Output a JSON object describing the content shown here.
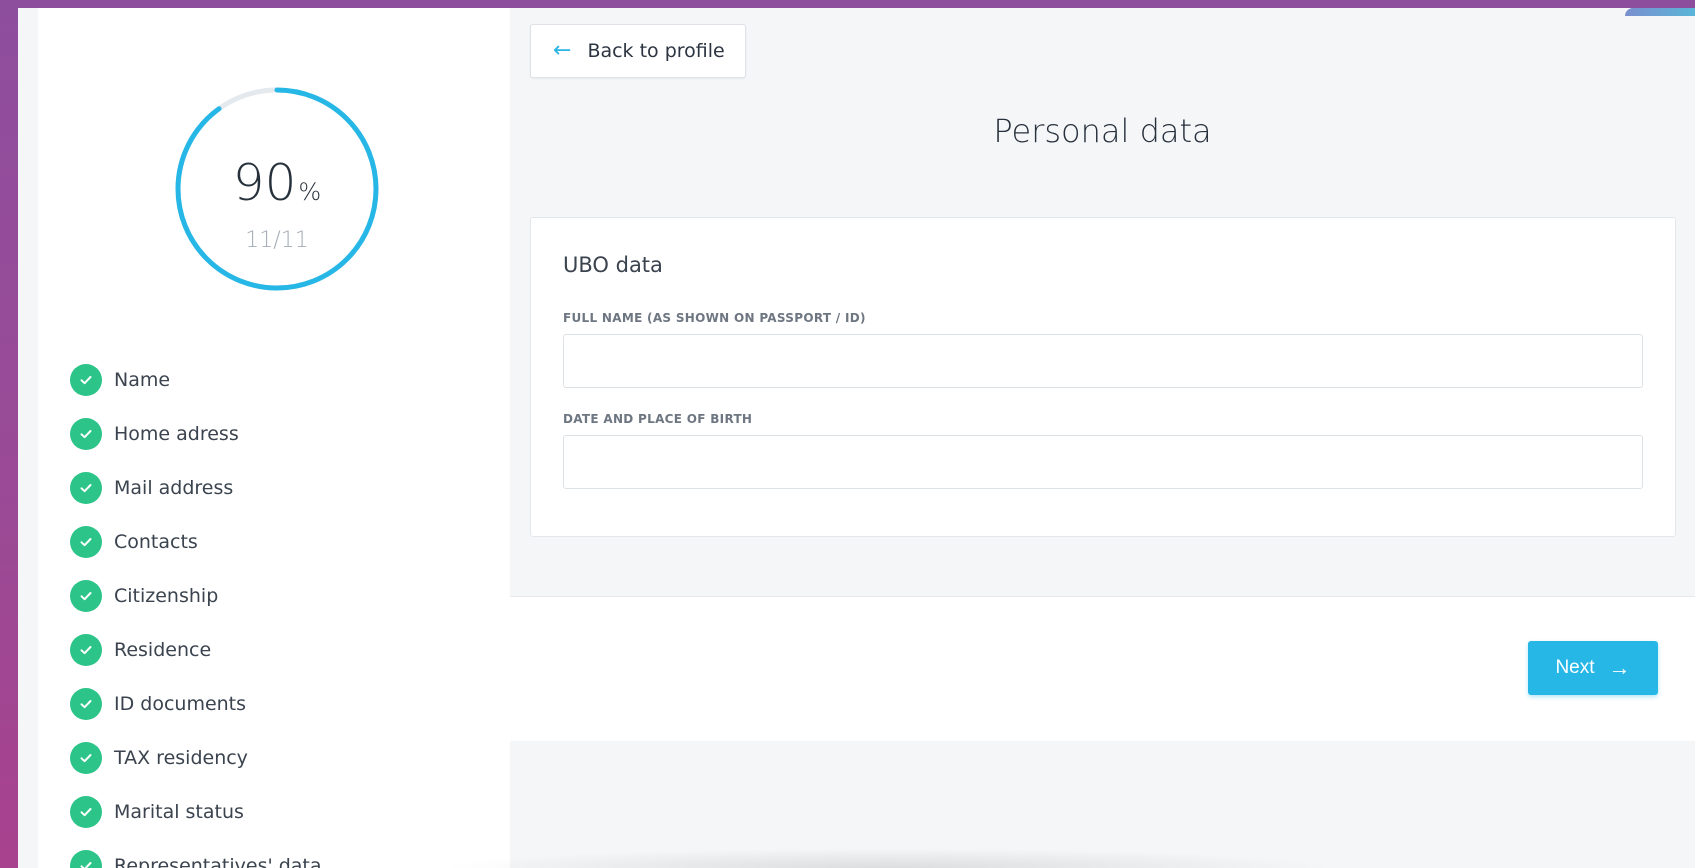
{
  "colors": {
    "accent": "#27b7e6",
    "success": "#2cc489",
    "progress_ring": "#27b7e6",
    "progress_track": "#e4e9ee"
  },
  "sidebar": {
    "progress": {
      "value": "90",
      "percent_sign": "%",
      "fraction": 0.9,
      "count": "11/11"
    },
    "steps": [
      {
        "label": "Name",
        "icon": "check-icon"
      },
      {
        "label": "Home adress",
        "icon": "check-icon"
      },
      {
        "label": "Mail address",
        "icon": "check-icon"
      },
      {
        "label": "Contacts",
        "icon": "check-icon"
      },
      {
        "label": "Citizenship",
        "icon": "check-icon"
      },
      {
        "label": "Residence",
        "icon": "check-icon"
      },
      {
        "label": "ID documents",
        "icon": "check-icon"
      },
      {
        "label": "TAX residency",
        "icon": "check-icon"
      },
      {
        "label": "Marital status",
        "icon": "check-icon"
      },
      {
        "label": "Representatives' data",
        "icon": "check-icon"
      }
    ]
  },
  "header": {
    "back_label": "Back to profile",
    "back_icon": "arrow-left-icon",
    "title": "Personal data"
  },
  "form": {
    "section_title": "UBO data",
    "fields": [
      {
        "label": "FULL NAME (AS SHOWN ON PASSPORT / ID)",
        "value": "",
        "placeholder": ""
      },
      {
        "label": "DATE AND PLACE OF BIRTH",
        "value": "",
        "placeholder": ""
      }
    ]
  },
  "footer": {
    "next_label": "Next",
    "next_icon": "arrow-right-icon"
  }
}
